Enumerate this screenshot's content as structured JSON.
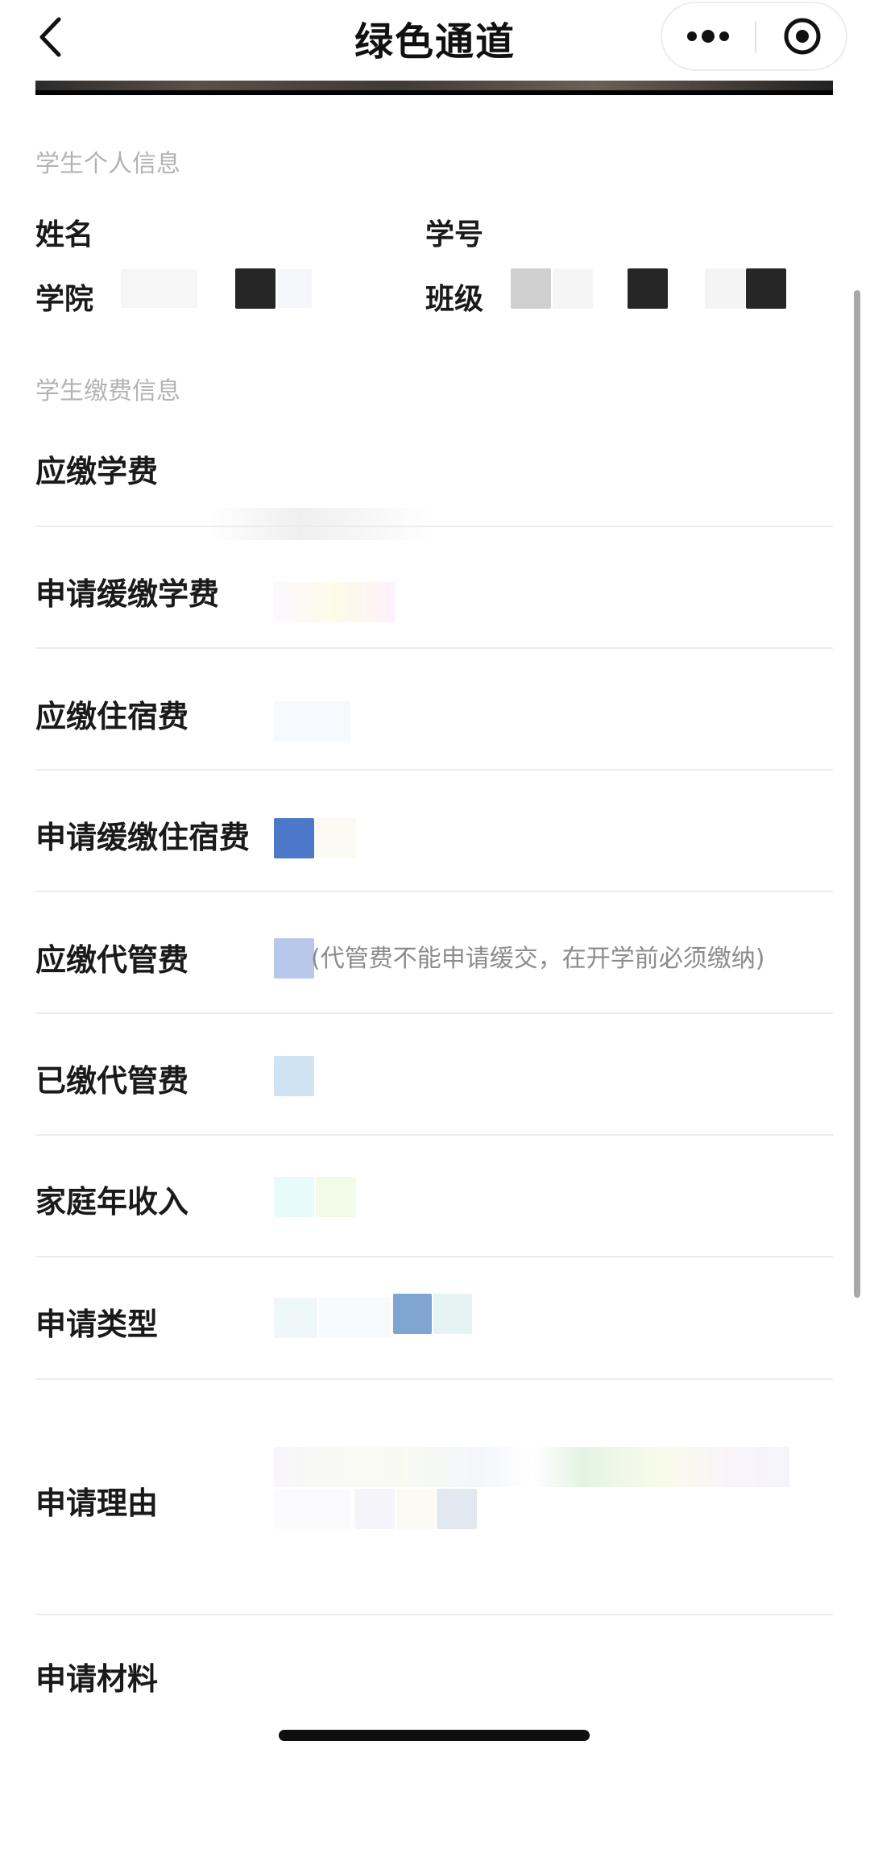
{
  "nav": {
    "title": "绿色通道",
    "back_icon": "chevron-left-icon",
    "more_icon": "more-dots-icon",
    "close_icon": "target-close-icon"
  },
  "personal_info": {
    "section_title": "学生个人信息",
    "name_label": "姓名",
    "student_id_label": "学号",
    "college_label": "学院",
    "class_label": "班级"
  },
  "payment_info": {
    "section_title": "学生缴费信息",
    "rows": [
      {
        "label": "应缴学费"
      },
      {
        "label": "申请缓缴学费"
      },
      {
        "label": "应缴住宿费"
      },
      {
        "label": "申请缓缴住宿费"
      },
      {
        "label": "应缴代管费",
        "note": "(代管费不能申请缓交，在开学前必须缴纳)"
      },
      {
        "label": "已缴代管费"
      },
      {
        "label": "家庭年收入"
      },
      {
        "label": "申请类型"
      },
      {
        "label": "申请理由"
      },
      {
        "label": "申请材料"
      }
    ]
  },
  "colors": {
    "accent_blue": "#4d78c9",
    "section_gray": "#b3b3b3",
    "divider": "#ececec"
  }
}
